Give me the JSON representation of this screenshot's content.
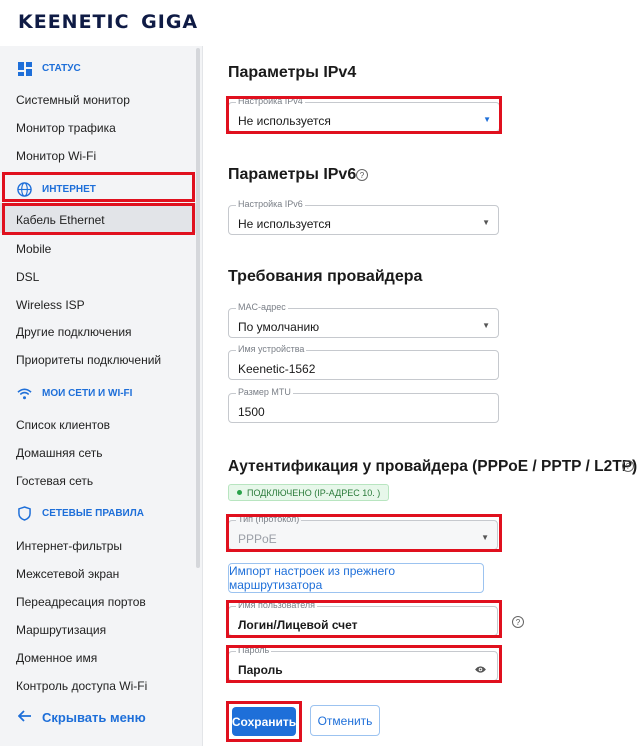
{
  "brand": {
    "name_part1": "KEENETIC",
    "name_part2": "GIGA"
  },
  "sidebar": {
    "sections": [
      {
        "label": "СТАТУС",
        "icon": "dashboard-icon"
      },
      {
        "label": "ИНТЕРНЕТ",
        "icon": "globe-icon"
      },
      {
        "label": "МОИ СЕТИ И WI-FI",
        "icon": "wifi-icon"
      },
      {
        "label": "СЕТЕВЫЕ ПРАВИЛА",
        "icon": "shield-icon"
      }
    ],
    "items": [
      "Системный монитор",
      "Монитор трафика",
      "Монитор Wi-Fi",
      "Кабель Ethernet",
      "Mobile",
      "DSL",
      "Wireless ISP",
      "Другие подключения",
      "Приоритеты подключений",
      "Список клиентов",
      "Домашняя сеть",
      "Гостевая сеть",
      "Интернет-фильтры",
      "Межсетевой экран",
      "Переадресация портов",
      "Маршрутизация",
      "Доменное имя",
      "Контроль доступа Wi-Fi"
    ],
    "hide_menu": "Скрывать меню"
  },
  "main": {
    "ipv4": {
      "title": "Параметры IPv4",
      "label": "Настройка IPv4",
      "value": "Не используется"
    },
    "ipv6": {
      "title": "Параметры IPv6",
      "label": "Настройка IPv6",
      "value": "Не используется"
    },
    "provider": {
      "title": "Требования провайдера",
      "mac_label": "MAC-адрес",
      "mac_value": "По умолчанию",
      "device_label": "Имя устройства",
      "device_value": "Keenetic-1562",
      "mtu_label": "Размер MTU",
      "mtu_value": "1500"
    },
    "auth": {
      "title": "Аутентификация у провайдера (PPPoE / PPTP / L2TP)",
      "status": "ПОДКЛЮЧЕНО (IP-АДРЕС 10.             )",
      "type_label": "Тип (протокол)",
      "type_value": "PPPoE",
      "import_button": "Импорт настроек из прежнего маршрутизатора",
      "user_label": "Имя пользователя",
      "user_value": "Логин/Лицевой счет",
      "pass_label": "Пароль",
      "pass_value": "Пароль"
    },
    "save": "Сохранить",
    "cancel": "Отменить"
  },
  "colors": {
    "accent": "#1e6fd9",
    "highlight": "#e0101e"
  }
}
